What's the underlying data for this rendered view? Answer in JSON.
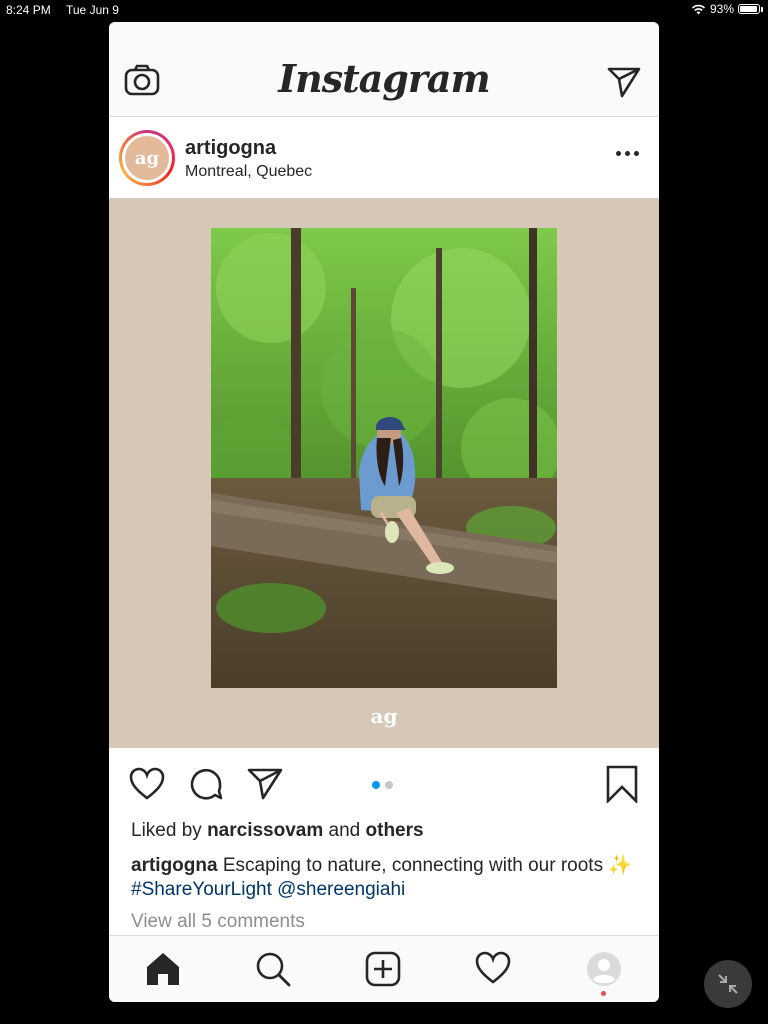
{
  "status_bar": {
    "time": "8:24 PM",
    "date": "Tue Jun 9",
    "battery": "93%",
    "battery_level": 0.93
  },
  "header": {
    "logo": "Instagram",
    "camera_icon": "camera-icon",
    "direct_icon": "paper-plane-icon"
  },
  "post": {
    "username": "artigogna",
    "location": "Montreal, Quebec",
    "avatar_text": "ag",
    "media_watermark": "ag",
    "carousel": {
      "count": 2,
      "active": 1
    },
    "likes": {
      "prefix": "Liked by",
      "user": "narcissovam",
      "joiner": "and",
      "others": "others"
    },
    "caption": {
      "user": "artigogna",
      "text": "Escaping to nature, connecting with our roots ✨",
      "hashtag": "#ShareYourLight",
      "mention": "@shereengiahi"
    },
    "view_comments": "View all 5 comments"
  },
  "tabbar": {
    "items": [
      "home-icon",
      "search-icon",
      "new-post-icon",
      "activity-icon",
      "profile-icon"
    ]
  },
  "colors": {
    "brand_bg": "#fafafa",
    "media_bg": "#d5c8b7",
    "link": "#003569",
    "active_dot": "#0095f6",
    "muted": "#8e8e8e",
    "notification": "#ed4956"
  }
}
